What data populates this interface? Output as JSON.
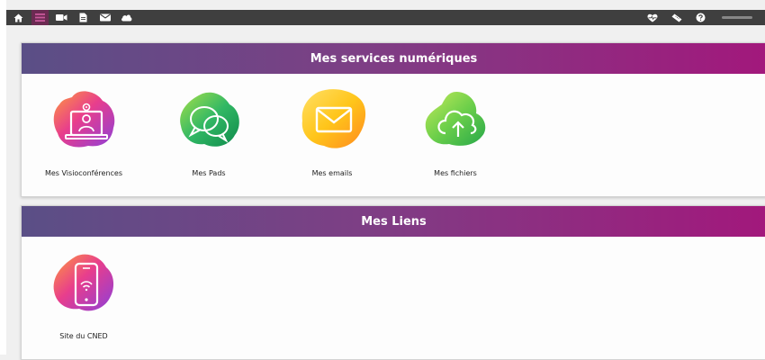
{
  "toolbar": {
    "left_icons": [
      "home-icon",
      "menu-icon",
      "video-icon",
      "document-icon",
      "mail-icon",
      "cloud-icon"
    ],
    "right_icons": [
      "heart-pulse-icon",
      "ticket-icon",
      "help-icon"
    ],
    "active_item": "menu"
  },
  "services": {
    "title": "Mes services numériques",
    "items": [
      {
        "label": "Mes Visioconférences",
        "icon": "videoconference-icon"
      },
      {
        "label": "Mes Pads",
        "icon": "chat-bubbles-icon"
      },
      {
        "label": "Mes emails",
        "icon": "envelope-icon"
      },
      {
        "label": "Mes fichiers",
        "icon": "cloud-upload-icon"
      }
    ]
  },
  "links": {
    "title": "Mes Liens",
    "items": [
      {
        "label": "Site du CNED",
        "icon": "smartphone-wifi-icon"
      }
    ]
  },
  "colors": {
    "toolbar_bg": "#3f3f3f",
    "active_tab": "#6b2a52",
    "header_gradient_start": "#5a4f86",
    "header_gradient_end": "#a2187c"
  }
}
